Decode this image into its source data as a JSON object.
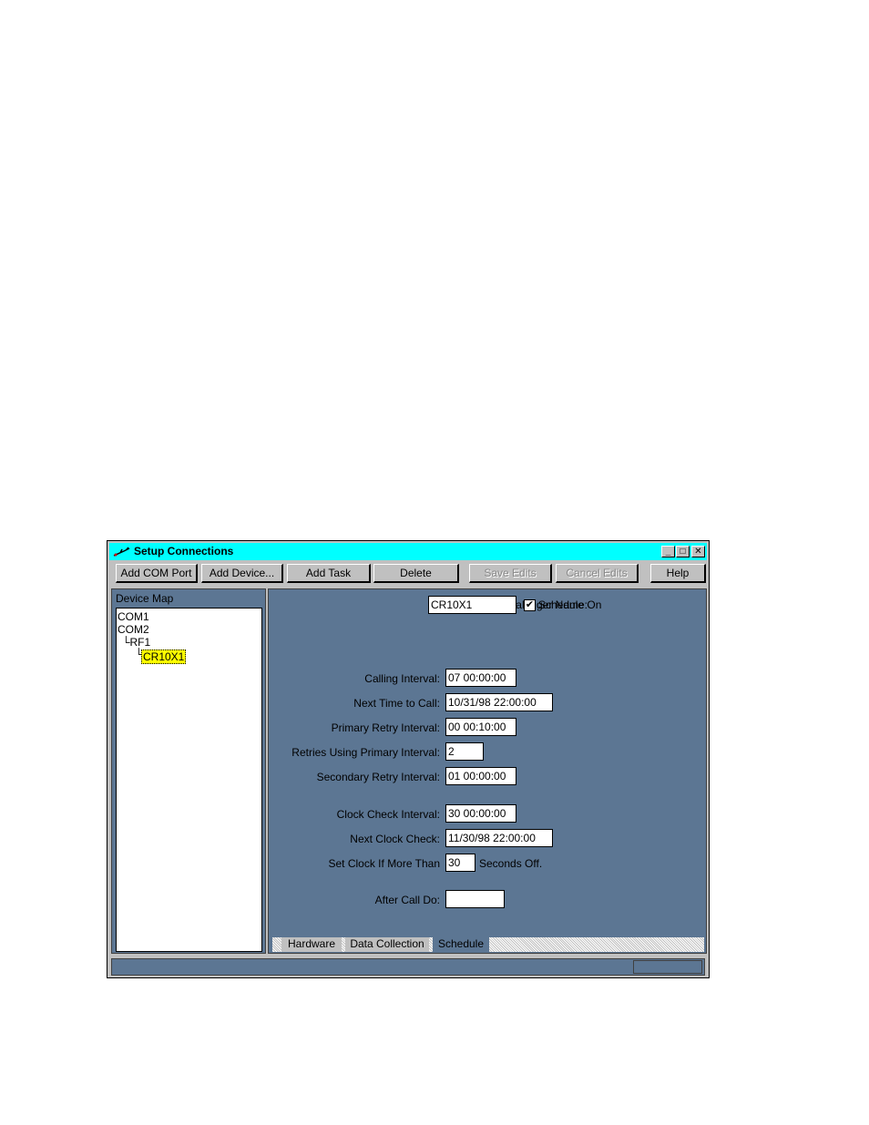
{
  "window": {
    "title": "Setup Connections",
    "controls": {
      "minimize": "_",
      "maximize": "□",
      "close": "✕"
    }
  },
  "toolbar": {
    "add_com_port": "Add COM Port",
    "add_device": "Add Device...",
    "add_task": "Add Task",
    "delete": "Delete",
    "save_edits": "Save Edits",
    "cancel_edits": "Cancel Edits",
    "help": "Help"
  },
  "device_map": {
    "label": "Device Map",
    "items": [
      "COM1",
      "COM2",
      "└RF1",
      "└",
      "CR10X1"
    ]
  },
  "form": {
    "datalogger_name_label": "CR10X Datalogger Name:",
    "datalogger_name_value": "CR10X1",
    "schedule_on_label": "Schedule On",
    "schedule_on_checked": "✔",
    "calling_interval_label": "Calling Interval:",
    "calling_interval_value": "07 00:00:00",
    "next_time_to_call_label": "Next Time to Call:",
    "next_time_to_call_value": "10/31/98 22:00:00",
    "primary_retry_label": "Primary Retry Interval:",
    "primary_retry_value": "00 00:10:00",
    "retries_primary_label": "Retries Using Primary Interval:",
    "retries_primary_value": "2",
    "secondary_retry_label": "Secondary Retry Interval:",
    "secondary_retry_value": "01 00:00:00",
    "clock_check_label": "Clock Check Interval:",
    "clock_check_value": "30 00:00:00",
    "next_clock_check_label": "Next Clock Check:",
    "next_clock_check_value": "11/30/98 22:00:00",
    "set_clock_label": "Set Clock If More Than",
    "set_clock_value": "30",
    "seconds_off_label": "Seconds Off.",
    "after_call_label": "After Call Do:",
    "after_call_value": ""
  },
  "tabs": [
    {
      "label": "Hardware",
      "active": false
    },
    {
      "label": "Data Collection",
      "active": false
    },
    {
      "label": "Schedule",
      "active": true
    }
  ],
  "colors": {
    "titlebar": "#00ffff",
    "pane": "#5c7693",
    "selection": "#ffff00"
  }
}
